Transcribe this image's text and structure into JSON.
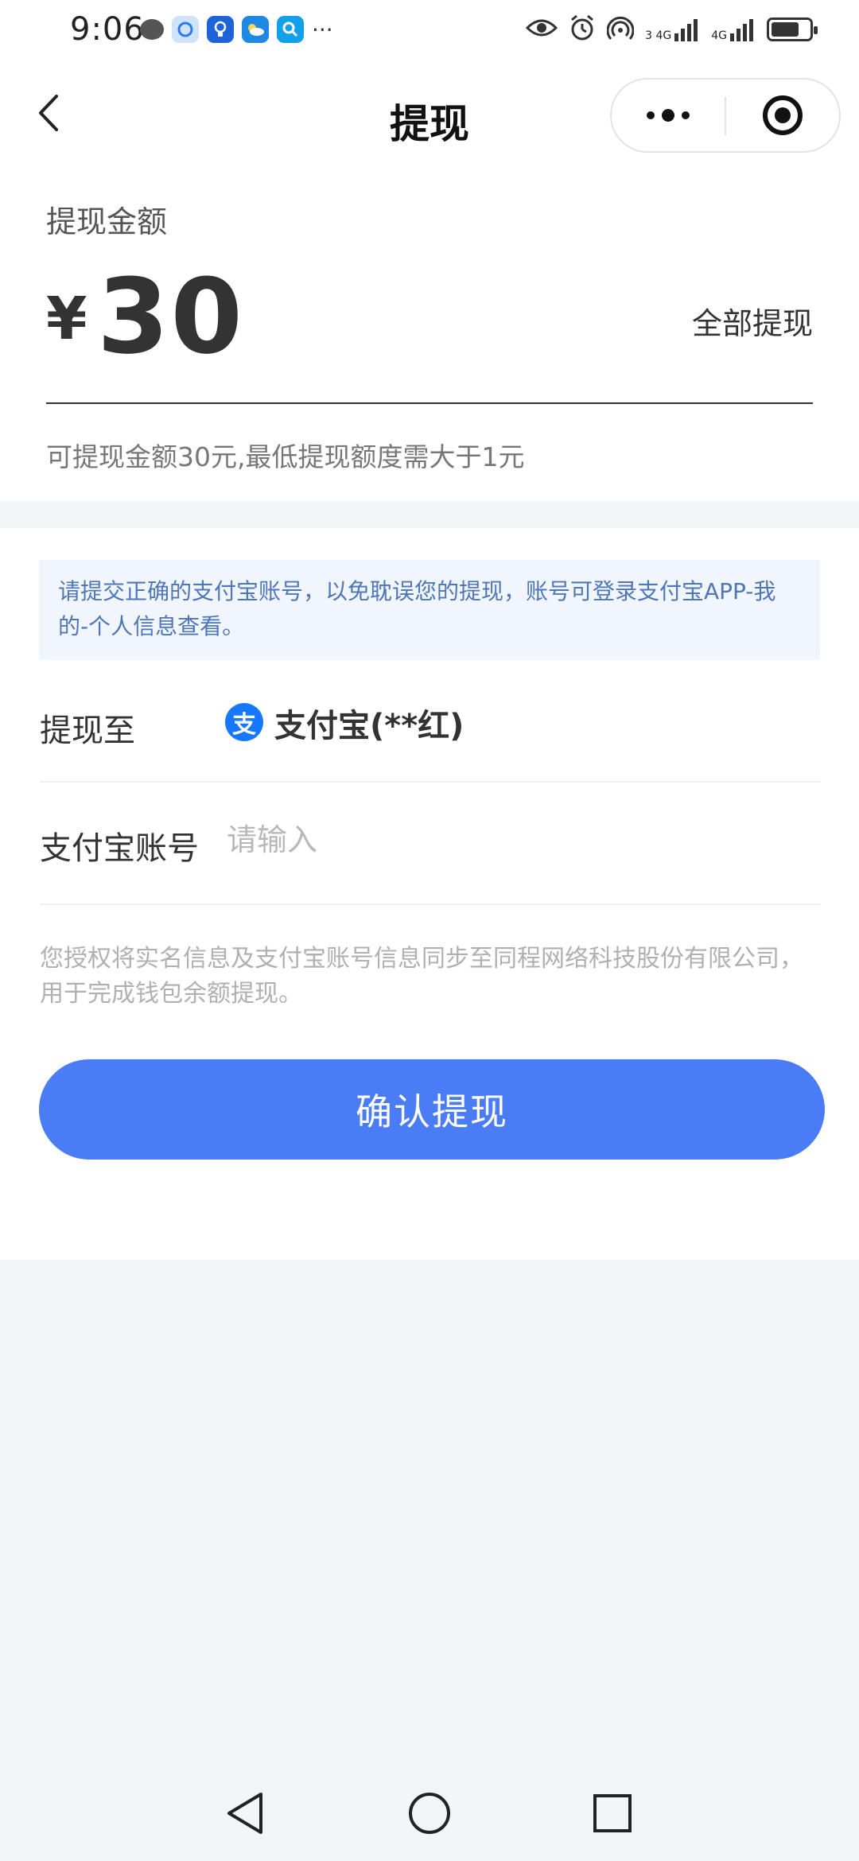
{
  "status_bar": {
    "time": "9:06",
    "left_icons": [
      "message-icon",
      "browser-icon",
      "bulb-app-icon",
      "weather-icon",
      "search-app-icon"
    ],
    "more_indicator": "···",
    "right_icons": [
      "eye-icon",
      "alarm-icon",
      "hotspot-icon",
      "signal-icon",
      "signal-icon",
      "battery-icon"
    ],
    "net1_label": "4G",
    "net1_sim": "3",
    "net2_label": "4G"
  },
  "navbar": {
    "title": "提现",
    "more_icon": "more-dots-icon",
    "close_icon": "target-icon"
  },
  "amount": {
    "label": "提现金额",
    "currency": "¥",
    "value": "30",
    "withdraw_all": "全部提现",
    "hint": "可提现金额30元,最低提现额度需大于1元"
  },
  "form": {
    "notice": "请提交正确的支付宝账号，以免耽误您的提现，账号可登录支付宝APP-我的-个人信息查看。",
    "withdraw_to_label": "提现至",
    "alipay_logo_char": "支",
    "alipay_name": "支付宝(**红)",
    "account_label": "支付宝账号",
    "account_placeholder": "请输入",
    "account_value": "",
    "consent": "您授权将实名信息及支付宝账号信息同步至同程网络科技股份有限公司，用于完成钱包余额提现。",
    "confirm_label": "确认提现"
  },
  "colors": {
    "primary_button": "#4a7cf6",
    "notice_bg": "#f1f6fd",
    "notice_text": "#4f76b8",
    "alipay_blue": "#1677ff",
    "page_bg": "#f4f5f7"
  }
}
